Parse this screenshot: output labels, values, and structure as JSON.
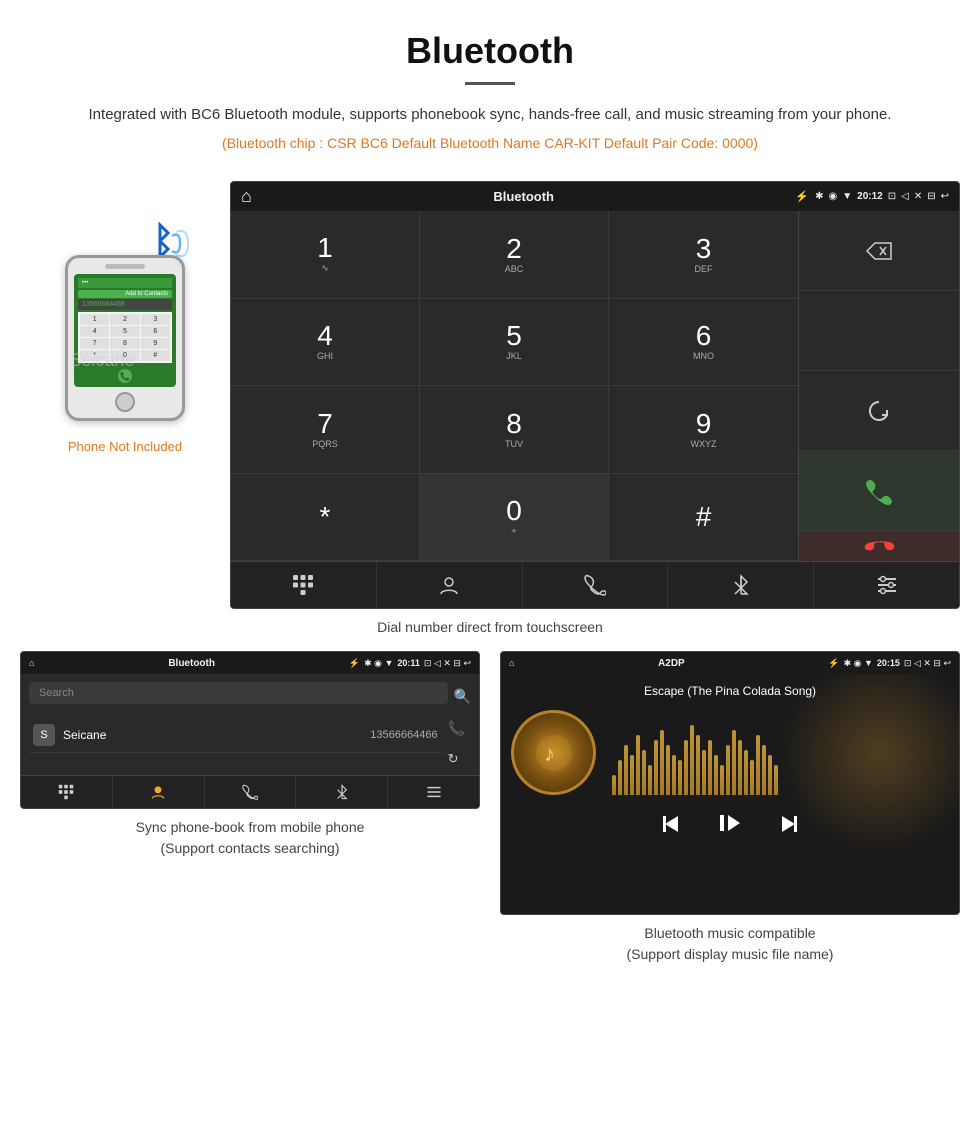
{
  "header": {
    "title": "Bluetooth",
    "description": "Integrated with BC6 Bluetooth module, supports phonebook sync, hands-free call, and music streaming from your phone.",
    "specs": "(Bluetooth chip : CSR BC6    Default Bluetooth Name CAR-KIT    Default Pair Code: 0000)"
  },
  "phone_aside": {
    "not_included_label": "Phone Not Included"
  },
  "large_screen": {
    "status_bar": {
      "home_icon": "⌂",
      "title": "Bluetooth",
      "usb_icon": "⚡",
      "bt_icon": "✱",
      "location_icon": "◉",
      "wifi_icon": "▲",
      "time": "20:12",
      "camera_icon": "⊡",
      "volume_icon": "◁",
      "close_icon": "✕",
      "window_icon": "⊟",
      "back_icon": "↩"
    },
    "dialer": {
      "keys": [
        {
          "number": "1",
          "letters": "∿"
        },
        {
          "number": "2",
          "letters": "ABC"
        },
        {
          "number": "3",
          "letters": "DEF"
        },
        {
          "number": "4",
          "letters": "GHI"
        },
        {
          "number": "5",
          "letters": "JKL"
        },
        {
          "number": "6",
          "letters": "MNO"
        },
        {
          "number": "7",
          "letters": "PQRS"
        },
        {
          "number": "8",
          "letters": "TUV"
        },
        {
          "number": "9",
          "letters": "WXYZ"
        },
        {
          "number": "*",
          "letters": ""
        },
        {
          "number": "0",
          "letters": "+"
        },
        {
          "number": "#",
          "letters": ""
        }
      ]
    },
    "bottom_nav": {
      "items": [
        "⊞",
        "👤",
        "📞",
        "✱",
        "✏"
      ]
    }
  },
  "main_caption": "Dial number direct from touchscreen",
  "phonebook_screen": {
    "status_bar": {
      "home_icon": "⌂",
      "title": "Bluetooth",
      "usb_icon": "⚡",
      "time": "20:11",
      "icons": "✱ ◉ ▲"
    },
    "search_placeholder": "Search",
    "contacts": [
      {
        "initial": "S",
        "name": "Seicane",
        "number": "13566664466"
      }
    ],
    "bottom_nav": [
      "⊞",
      "👤",
      "📞",
      "✱",
      "✏"
    ]
  },
  "phonebook_caption": "Sync phone-book from mobile phone\n(Support contacts searching)",
  "music_screen": {
    "status_bar": {
      "home_icon": "⌂",
      "title": "A2DP",
      "usb_icon": "⚡",
      "time": "20:15",
      "icons": "✱ ◉ ▲"
    },
    "song_title": "Escape (The Pina Colada Song)",
    "music_icon": "♪",
    "wave_heights": [
      20,
      35,
      50,
      40,
      60,
      45,
      30,
      55,
      65,
      50,
      40,
      35,
      55,
      70,
      60,
      45,
      55,
      40,
      30,
      50,
      65,
      55,
      45,
      35,
      60,
      50,
      40,
      30
    ],
    "controls": {
      "prev": "⏮",
      "play_pause": "⏯",
      "next": "⏭"
    }
  },
  "music_caption": "Bluetooth music compatible\n(Support display music file name)"
}
